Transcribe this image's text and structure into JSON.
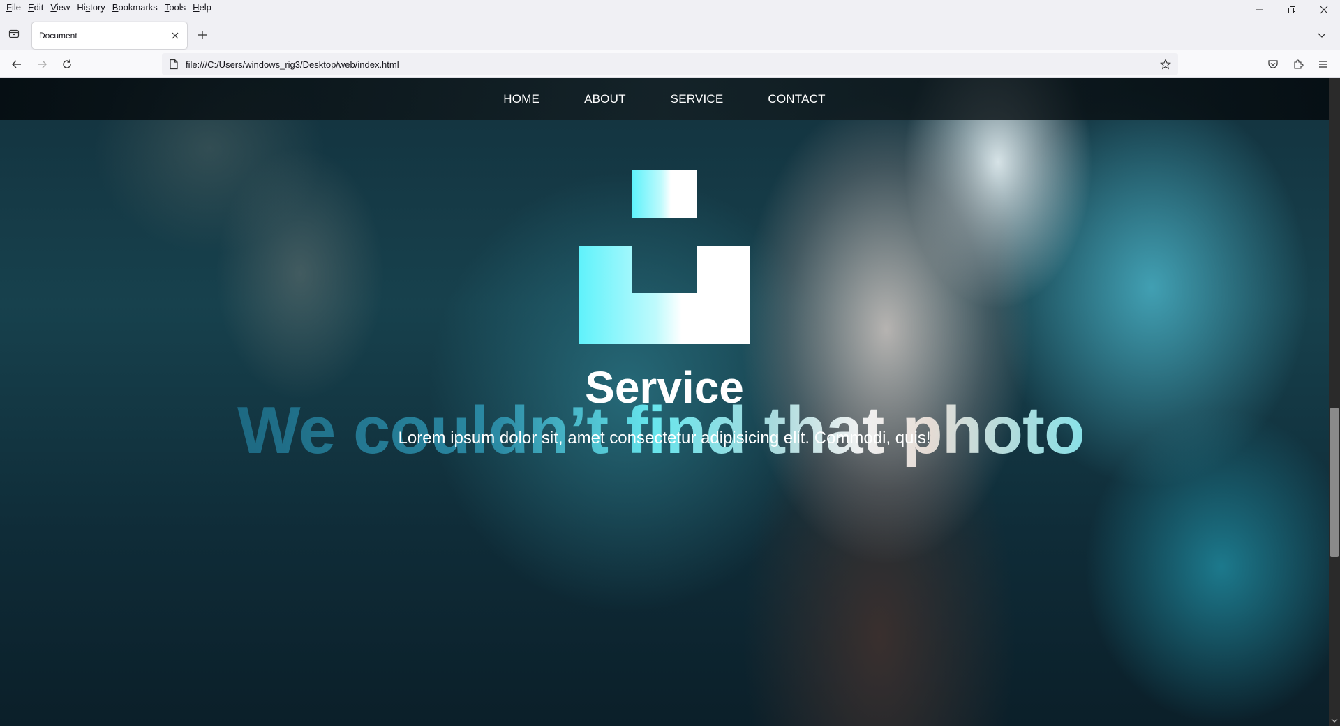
{
  "menu": {
    "items": [
      {
        "pre": "",
        "u": "F",
        "post": "ile"
      },
      {
        "pre": "",
        "u": "E",
        "post": "dit"
      },
      {
        "pre": "",
        "u": "V",
        "post": "iew"
      },
      {
        "pre": "Hi",
        "u": "s",
        "post": "tory"
      },
      {
        "pre": "",
        "u": "B",
        "post": "ookmarks"
      },
      {
        "pre": "",
        "u": "T",
        "post": "ools"
      },
      {
        "pre": "",
        "u": "H",
        "post": "elp"
      }
    ]
  },
  "tab": {
    "title": "Document"
  },
  "address": {
    "url": "file:///C:/Users/windows_rig3/Desktop/web/index.html"
  },
  "site_nav": {
    "links": [
      "HOME",
      "ABOUT",
      "SERVICE",
      "CONTACT"
    ]
  },
  "hero": {
    "missing_image_text": "We couldn’t find that photo",
    "title": "Service",
    "subtitle": "Lorem ipsum dolor sit, amet consectetur adipisicing elit. Commodi, quis!"
  },
  "icons": {
    "tab_list": "tab-list-icon",
    "close_tab": "close-icon",
    "new_tab": "plus-icon",
    "back": "back-arrow-icon",
    "forward": "forward-arrow-icon",
    "reload": "reload-icon",
    "page": "page-icon",
    "bookmark": "star-icon",
    "pocket": "pocket-icon",
    "extensions": "puzzle-icon",
    "app_menu": "hamburger-icon"
  }
}
